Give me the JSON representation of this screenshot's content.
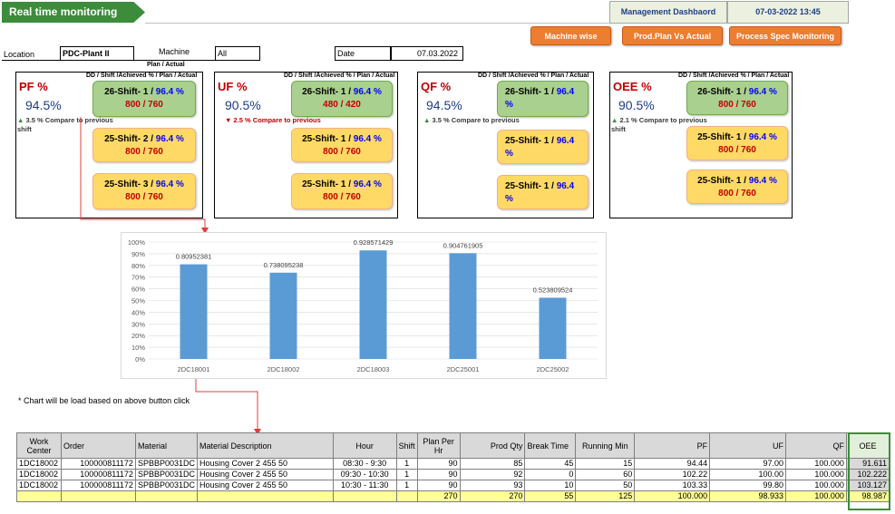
{
  "header": {
    "title": "Real time monitoring",
    "management_dashboard": "Management Dashbaord",
    "datetime": "07-03-2022 13:45"
  },
  "buttons": {
    "machine_wise": "Machine wise",
    "prod_plan": "Prod.Plan Vs Actual",
    "process_spec": "Process Spec Monitoring"
  },
  "filters": {
    "location_label": "Location",
    "location_value": "PDC-Plant II",
    "machine_label": "Machine",
    "machine_value": "All",
    "date_label": "Date",
    "date_value": "07.03.2022"
  },
  "panels": {
    "pf": {
      "sub_header": "Plan / Actual",
      "header": "DD / Shift /Achieved % / Plan / Actual",
      "label": "PF %",
      "value": "94.5%",
      "compare": "3.5 % Compare to previous shift",
      "trend": "up",
      "cards": [
        {
          "shift": "26-Shift- 1 /",
          "pct": "96.4 %",
          "plan": "800 / 760"
        },
        {
          "shift": "25-Shift- 2 /",
          "pct": "96.4 %",
          "plan": "800 / 760"
        },
        {
          "shift": "25-Shift- 3 /",
          "pct": "96.4 %",
          "plan": "800 / 760"
        }
      ]
    },
    "uf": {
      "header": "DD / Shift /Achieved % / Plan / Actual",
      "label": "UF %",
      "value": "90.5%",
      "compare": "2.5 % Compare to previous",
      "trend": "down",
      "cards": [
        {
          "shift": "26-Shift- 1 /",
          "pct": "96.4 %",
          "plan": "480 / 420"
        },
        {
          "shift": "25-Shift- 1 /",
          "pct": "96.4 %",
          "plan": "800 / 760"
        },
        {
          "shift": "25-Shift- 1 /",
          "pct": "96.4 %",
          "plan": "800 / 760"
        }
      ]
    },
    "qf": {
      "header": "DD / Shift /Achieved % / Plan / Actual",
      "label": "QF %",
      "value": "94.5%",
      "compare": "3.5 % Compare to previous",
      "trend": "up",
      "cards": [
        {
          "shift": "26-Shift- 1 /",
          "pct": "96.4",
          "pct2": "%"
        },
        {
          "shift": "25-Shift- 1 /",
          "pct": "96.4",
          "pct2": "%"
        },
        {
          "shift": "25-Shift- 1 /",
          "pct": "96.4",
          "pct2": "%"
        }
      ]
    },
    "oee": {
      "header": "DD / Shift /Achieved % / Plan / Actual",
      "label": "OEE %",
      "value": "90.5%",
      "compare": "2.1 % Compare to previous shift",
      "trend": "up",
      "cards": [
        {
          "shift": "26-Shift- 1 /",
          "pct": "96.4 %",
          "plan": "800 / 760"
        },
        {
          "shift": "25-Shift- 1 /",
          "pct": "96.4 %",
          "plan": "800 / 760"
        },
        {
          "shift": "25-Shift- 1 /",
          "pct": "96.4 %",
          "plan": "800 / 760"
        }
      ]
    }
  },
  "chart_data": {
    "type": "bar",
    "categories": [
      "2DC18001",
      "2DC18002",
      "2DC18003",
      "2DC25001",
      "2DC25002"
    ],
    "values": [
      0.80952381,
      0.738095238,
      0.928571429,
      0.904761905,
      0.523809524
    ],
    "value_labels": [
      "0.80952381",
      "0.738095238",
      "0.928571429",
      "0.904761905",
      "0.523809524"
    ],
    "y_ticks": [
      "0%",
      "10%",
      "20%",
      "30%",
      "40%",
      "50%",
      "60%",
      "70%",
      "80%",
      "90%",
      "100%"
    ],
    "ylim": [
      0,
      1
    ],
    "bar_color": "#5b9bd5"
  },
  "note": "* Chart will be load based on above button click",
  "table": {
    "headers": [
      "Work Center",
      "Order",
      "Material",
      "Material Description",
      "Hour",
      "Shift",
      "Plan Per Hr",
      "Prod Qty",
      "Break Time",
      "Running Min",
      "PF",
      "UF",
      "QF",
      "OEE"
    ],
    "rows": [
      [
        "1DC18002",
        "100000811172",
        "SPBBP0031DC",
        "Housing Cover 2 455 50",
        "08:30 - 9:30",
        "1",
        "90",
        "85",
        "45",
        "15",
        "94.44",
        "97.00",
        "100.000",
        "91.611"
      ],
      [
        "1DC18002",
        "100000811172",
        "SPBBP0031DC",
        "Housing Cover 2 455 50",
        "09:30 - 10:30",
        "1",
        "90",
        "92",
        "0",
        "60",
        "102.22",
        "100.00",
        "100.000",
        "102.222"
      ],
      [
        "1DC18002",
        "100000811172",
        "SPBBP0031DC",
        "Housing Cover 2 455 50",
        "10:30 - 11:30",
        "1",
        "90",
        "93",
        "10",
        "50",
        "103.33",
        "99.80",
        "100.000",
        "103.127"
      ]
    ],
    "total": [
      "",
      "",
      "",
      "",
      "",
      "",
      "270",
      "270",
      "55",
      "125",
      "100.000",
      "98.933",
      "100.000",
      "98.987"
    ]
  }
}
